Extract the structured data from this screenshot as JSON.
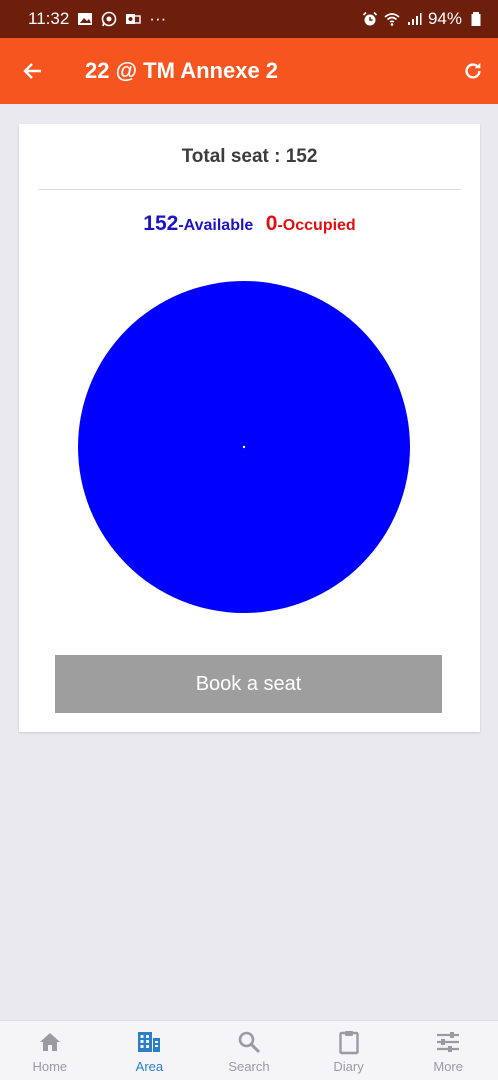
{
  "status_bar": {
    "time": "11:32",
    "more": "···",
    "battery": "94%"
  },
  "header": {
    "title": "22 @ TM Annexe 2"
  },
  "summary": {
    "total_seat": "Total seat : 152",
    "available_count": "152",
    "available_label": "-Available",
    "occupied_count": "0",
    "occupied_label": "-Occupied"
  },
  "chart_data": {
    "type": "pie",
    "categories": [
      "Available",
      "Occupied"
    ],
    "values": [
      152,
      0
    ],
    "colors": [
      "#0000ff",
      "#ff0000"
    ],
    "title": ""
  },
  "book_button": {
    "label": "Book a seat"
  },
  "bottom_nav": {
    "items": [
      {
        "label": "Home",
        "icon": "home-icon",
        "active": false
      },
      {
        "label": "Area",
        "icon": "building-icon",
        "active": true
      },
      {
        "label": "Search",
        "icon": "search-icon",
        "active": false
      },
      {
        "label": "Diary",
        "icon": "clipboard-icon",
        "active": false
      },
      {
        "label": "More",
        "icon": "sliders-icon",
        "active": false
      }
    ]
  },
  "colors": {
    "status_bar": "#6e1f0c",
    "app_bar": "#f6551f",
    "active_tab": "#2a7fc8",
    "button": "#9e9e9e"
  }
}
